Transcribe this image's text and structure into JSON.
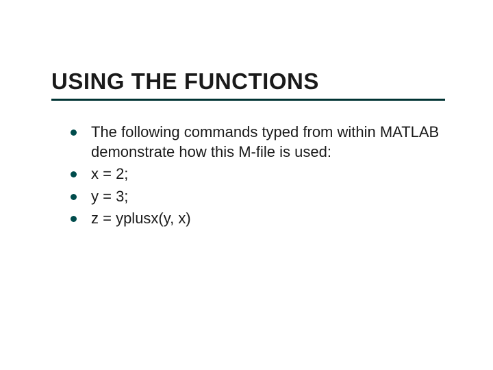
{
  "title": "USING THE FUNCTIONS",
  "bullets": [
    "The following commands typed from within MATLAB demonstrate how this M-file is used:",
    "x = 2;",
    "y = 3;",
    "z = yplusx(y, x)"
  ]
}
